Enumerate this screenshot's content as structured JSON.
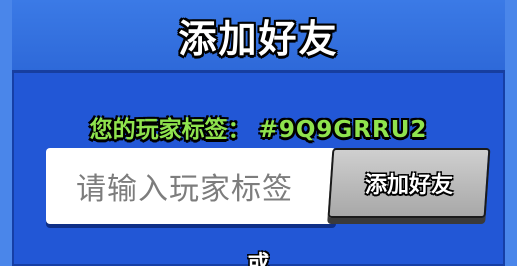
{
  "dialog": {
    "title": "添加好友",
    "tag_label": "您的玩家标签：",
    "tag_value": "#9Q9GRRU2"
  },
  "form": {
    "input_placeholder": "请输入玩家标签",
    "add_button_label": "添加好友",
    "or_text": "或"
  },
  "colors": {
    "background": "#1c4fd1",
    "panel": "#2257d6",
    "header": "#3b7ae6",
    "tag_green": "#8fe34d",
    "button_gray": "#bdbdbd"
  }
}
